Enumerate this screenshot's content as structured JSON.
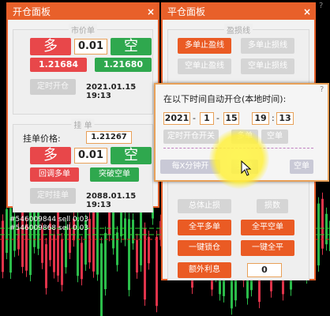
{
  "chart": {
    "labels": [
      "#546009844 sell 0.03",
      "#546009868 sell 0.03"
    ]
  },
  "open_panel": {
    "title": "开仓面板",
    "close": "×",
    "market_section": "市价单",
    "buy_label": "多",
    "lot_value": "0.01",
    "sell_label": "空",
    "buy_price": "1.21684",
    "sell_price": "1.21680",
    "timed_open_btn": "定时开仓",
    "timed_open_time": "2021.01.15 19:13",
    "pending_section": "挂 单",
    "pending_price_label": "挂单价格:",
    "pending_price_value": "1.21267",
    "pending_buy_label": "多",
    "pending_lot_value": "0.01",
    "pending_sell_label": "空",
    "pullback_buy_btn": "回调多单",
    "breakout_sell_btn": "突破空单",
    "timed_pending_btn": "定时挂单",
    "timed_pending_time": "2088.01.15 19:13"
  },
  "close_panel": {
    "title": "平仓面板",
    "close": "×",
    "tp_section": "盈损线",
    "buttons": [
      {
        "label": "多单止盈线",
        "style": "org"
      },
      {
        "label": "多单止损线",
        "style": "gry"
      },
      {
        "label": "空单止盈线",
        "style": "gry"
      },
      {
        "label": "空单止损线",
        "style": "gry"
      },
      {
        "label": "总体止损",
        "style": "gry"
      },
      {
        "label": "损数",
        "style": "gry"
      },
      {
        "label": "全平多单",
        "style": "org"
      },
      {
        "label": "全平空单",
        "style": "org"
      },
      {
        "label": "一键锁仓",
        "style": "org"
      },
      {
        "label": "一键全平",
        "style": "org"
      },
      {
        "label": "额外利息",
        "style": "org"
      }
    ],
    "extra_value": "0"
  },
  "timer_popup": {
    "prompt": "在以下时间自动开仓(本地时间):",
    "year": "2021",
    "month": "1",
    "day": "15",
    "hour": "19",
    "minute": "13",
    "timed_btn": "定时开仓开关",
    "buy_btn": "多单",
    "sell_btn": "空单",
    "row2_left": "每X分钟开",
    "row2_mid": "多单",
    "row2_sell": "空单",
    "help": "?"
  },
  "colors": {
    "accent": "#e8602a",
    "buy": "#e8474a",
    "sell": "#2fa84e"
  }
}
